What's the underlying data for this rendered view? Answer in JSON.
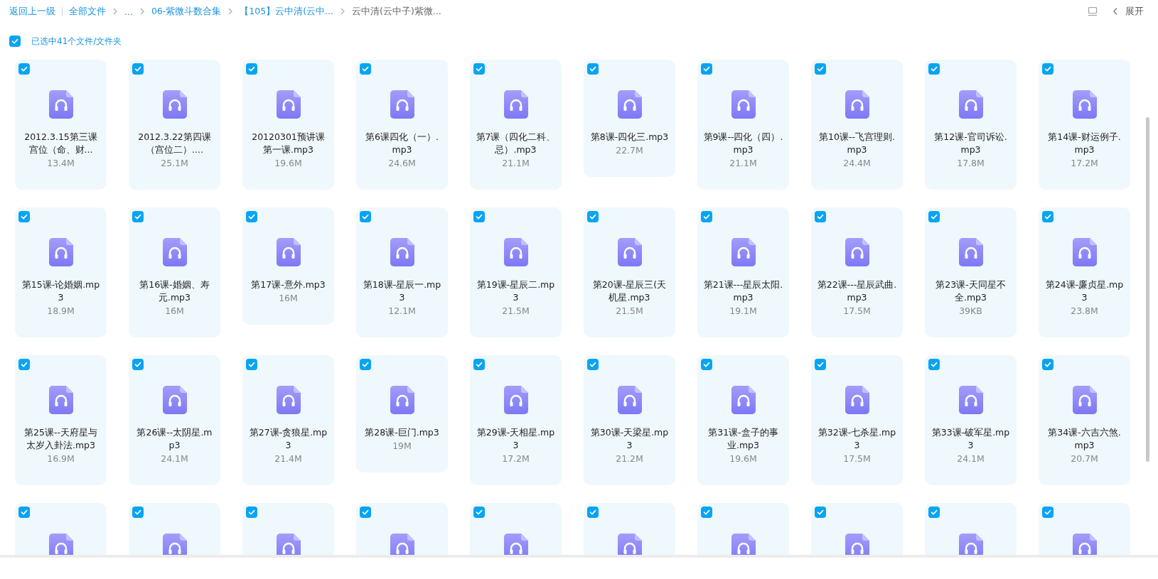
{
  "breadcrumb": {
    "back": "返回上一级",
    "items": [
      {
        "label": "全部文件",
        "current": false
      },
      {
        "label": "...",
        "current": false
      },
      {
        "label": "06-紫微斗数合集",
        "current": false
      },
      {
        "label": "【105】云中清(云中...",
        "current": false
      },
      {
        "label": "云中清(云中子)紫微...",
        "current": true
      }
    ]
  },
  "toolbar": {
    "expand_label": "展开"
  },
  "selection": {
    "checked": true,
    "label": "已选中41个文件/文件夹"
  },
  "files": [
    {
      "name": "2012.3.15第三课宫位（命、财...",
      "size": "13.4M",
      "checked": true
    },
    {
      "name": "2012.3.22第四课（宫位二）....",
      "size": "25.1M",
      "checked": true
    },
    {
      "name": "20120301预讲课第一课.mp3",
      "size": "19.6M",
      "checked": true
    },
    {
      "name": "第6课四化（一）.mp3",
      "size": "24.6M",
      "checked": true
    },
    {
      "name": "第7课（四化二科、忌）.mp3",
      "size": "21.1M",
      "checked": true
    },
    {
      "name": "第8课-四化三.mp3",
      "size": "22.7M",
      "checked": true
    },
    {
      "name": "第9课--四化（四）.mp3",
      "size": "21.1M",
      "checked": true
    },
    {
      "name": "第10课--飞宫理则.mp3",
      "size": "24.4M",
      "checked": true
    },
    {
      "name": "第12课-官司诉讼.mp3",
      "size": "17.8M",
      "checked": true
    },
    {
      "name": "第14课-财运例子.mp3",
      "size": "17.2M",
      "checked": true
    },
    {
      "name": "第15课-论婚姻.mp3",
      "size": "18.9M",
      "checked": true
    },
    {
      "name": "第16课-婚姻、寿元.mp3",
      "size": "16M",
      "checked": true
    },
    {
      "name": "第17课-意外.mp3",
      "size": "16M",
      "checked": true
    },
    {
      "name": "第18课-星辰一.mp3",
      "size": "12.1M",
      "checked": true
    },
    {
      "name": "第19课-星辰二.mp3",
      "size": "21.5M",
      "checked": true
    },
    {
      "name": "第20课-星辰三(天机星.mp3",
      "size": "21.5M",
      "checked": true
    },
    {
      "name": "第21课---星辰太阳.mp3",
      "size": "19.1M",
      "checked": true
    },
    {
      "name": "第22课---星辰武曲.mp3",
      "size": "17.5M",
      "checked": true
    },
    {
      "name": "第23课-天同星不全.mp3",
      "size": "39KB",
      "checked": true
    },
    {
      "name": "第24课-廉贞星.mp3",
      "size": "23.8M",
      "checked": true
    },
    {
      "name": "第25课--天府星与太岁入卦法.mp3",
      "size": "16.9M",
      "checked": true
    },
    {
      "name": "第26课--太阴星.mp3",
      "size": "24.1M",
      "checked": true
    },
    {
      "name": "第27课-贪狼星.mp3",
      "size": "21.4M",
      "checked": true
    },
    {
      "name": "第28课-巨门.mp3",
      "size": "19M",
      "checked": true
    },
    {
      "name": "第29课-天相星.mp3",
      "size": "17.2M",
      "checked": true
    },
    {
      "name": "第30课-天梁星.mp3",
      "size": "21.2M",
      "checked": true
    },
    {
      "name": "第31课-盒子的事业.mp3",
      "size": "19.6M",
      "checked": true
    },
    {
      "name": "第32课-七杀星.mp3",
      "size": "17.5M",
      "checked": true
    },
    {
      "name": "第33课-破军星.mp3",
      "size": "24.1M",
      "checked": true
    },
    {
      "name": "第34课-六吉六煞.mp3",
      "size": "20.7M",
      "checked": true
    },
    {
      "checked": true
    },
    {
      "checked": true
    },
    {
      "checked": true
    },
    {
      "checked": true
    },
    {
      "checked": true
    },
    {
      "checked": true
    },
    {
      "checked": true
    },
    {
      "checked": true
    },
    {
      "checked": true
    },
    {
      "checked": true
    }
  ]
}
